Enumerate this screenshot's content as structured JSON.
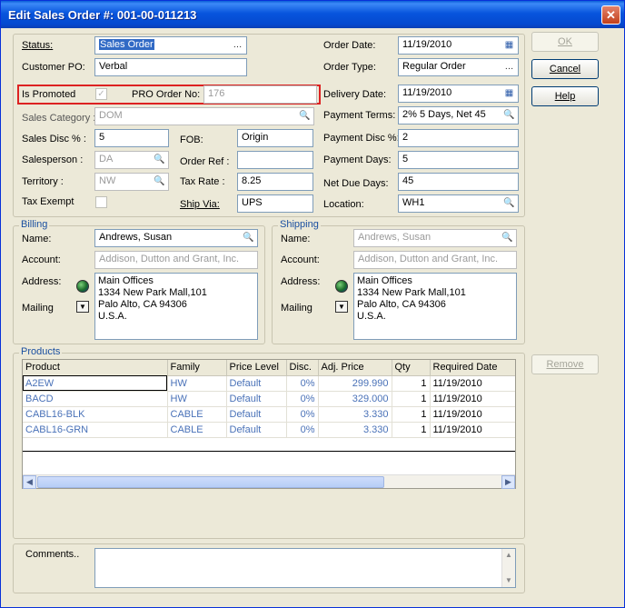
{
  "window": {
    "title": "Edit Sales Order #: 001-00-011213",
    "close_glyph": "✕"
  },
  "header": {
    "status_label": "Status:",
    "status_value": "Sales Order",
    "customer_po_label": "Customer PO:",
    "customer_po_value": "Verbal",
    "is_promoted_label": "Is Promoted",
    "is_promoted_checked": true,
    "pro_order_no_label": "PRO Order No:",
    "pro_order_no_value": "176",
    "sales_category_label": "Sales Category :",
    "sales_category_value": "DOM",
    "sales_disc_label": "Sales Disc % :",
    "sales_disc_value": "5",
    "salesperson_label": "Salesperson :",
    "salesperson_value": "DA",
    "territory_label": "Territory :",
    "territory_value": "NW",
    "tax_exempt_label": "Tax Exempt",
    "tax_exempt_checked": false,
    "fob_label": "FOB:",
    "fob_value": "Origin",
    "order_ref_label": "Order Ref :",
    "order_ref_value": "",
    "tax_rate_label": "Tax Rate :",
    "tax_rate_value": "8.25",
    "ship_via_label": "Ship Via:",
    "ship_via_value": "UPS",
    "order_date_label": "Order Date:",
    "order_date_value": "11/19/2010",
    "order_type_label": "Order Type:",
    "order_type_value": "Regular Order",
    "delivery_date_label": "Delivery Date:",
    "delivery_date_value": "11/19/2010",
    "payment_terms_label": "Payment Terms:",
    "payment_terms_value": "2% 5 Days, Net 45",
    "payment_disc_label": "Payment Disc %:",
    "payment_disc_value": "2",
    "payment_days_label": "Payment Days:",
    "payment_days_value": "5",
    "net_due_days_label": "Net Due Days:",
    "net_due_days_value": "45",
    "location_label": "Location:",
    "location_value": "WH1"
  },
  "billing": {
    "group_label": "Billing",
    "name_label": "Name:",
    "name_value": "Andrews, Susan",
    "account_label": "Account:",
    "account_value": "Addison, Dutton and Grant, Inc.",
    "address_label": "Address:",
    "mailing_label": "Mailing",
    "address_lines": [
      "Main Offices",
      "1334 New Park Mall,101",
      "Palo Alto, CA 94306",
      "U.S.A."
    ]
  },
  "shipping": {
    "group_label": "Shipping",
    "name_label": "Name:",
    "name_value": "Andrews, Susan",
    "account_label": "Account:",
    "account_value": "Addison, Dutton and Grant, Inc.",
    "address_label": "Address:",
    "mailing_label": "Mailing",
    "address_lines": [
      "Main Offices",
      "1334 New Park Mall,101",
      "Palo Alto, CA 94306",
      "U.S.A."
    ]
  },
  "products": {
    "group_label": "Products",
    "columns": [
      "Product",
      "Family",
      "Price Level",
      "Disc.",
      "Adj. Price",
      "Qty",
      "Required Date"
    ],
    "rows": [
      [
        "A2EW",
        "HW",
        "Default",
        "0%",
        "299.990",
        "1",
        "11/19/2010"
      ],
      [
        "BACD",
        "HW",
        "Default",
        "0%",
        "329.000",
        "1",
        "11/19/2010"
      ],
      [
        "CABL16-BLK",
        "CABLE",
        "Default",
        "0%",
        "3.330",
        "1",
        "11/19/2010"
      ],
      [
        "CABL16-GRN",
        "CABLE",
        "Default",
        "0%",
        "3.330",
        "1",
        "11/19/2010"
      ]
    ],
    "scroll_left_glyph": "◀",
    "scroll_right_glyph": "▶"
  },
  "comments": {
    "label": "Comments..",
    "value": ""
  },
  "buttons": {
    "ok": "OK",
    "cancel": "Cancel",
    "help": "Help",
    "remove": "Remove"
  },
  "icons": {
    "status": "ellipsis-icon",
    "order_date": "calendar-icon",
    "order_type": "ellipsis-icon",
    "delivery_date": "calendar-icon",
    "payment_terms": "search-icon",
    "location": "search-icon",
    "sales_category": "search-icon",
    "salesperson": "search-icon",
    "territory": "search-icon",
    "billing_name": "search-icon",
    "shipping_name": "search-icon",
    "address_globe": "globe-icon",
    "mailing_dropdown": "dropdown-icon"
  },
  "colors": {
    "title_bar": "#0855dd",
    "highlight_box": "#dd2222",
    "group_label": "#1a4fa0",
    "row_text": "#4a72b8"
  }
}
